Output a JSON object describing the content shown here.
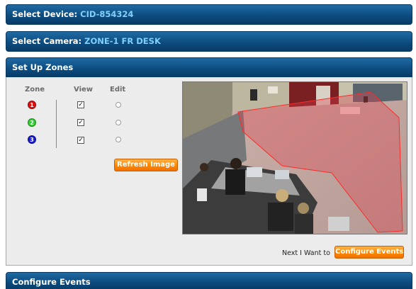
{
  "device": {
    "label": "Select Device:",
    "value": "CID-854324"
  },
  "camera": {
    "label": "Select Camera:",
    "value": "ZONE-1 FR DESK"
  },
  "zones_section": {
    "title": "Set Up Zones",
    "headers": {
      "zone": "Zone",
      "view": "View",
      "edit": "Edit"
    },
    "zones": [
      {
        "number": "1",
        "color": "#e01010",
        "view_checked": "✓"
      },
      {
        "number": "2",
        "color": "#30d030",
        "view_checked": "✓"
      },
      {
        "number": "3",
        "color": "#1a1ad0",
        "view_checked": "✓"
      }
    ],
    "refresh_label": "Refresh Image",
    "zone_overlay_color": "#e0404a"
  },
  "footer": {
    "next_text": "Next I Want to",
    "configure_label": "Configure Events"
  },
  "events_section": {
    "title": "Configure Events"
  }
}
